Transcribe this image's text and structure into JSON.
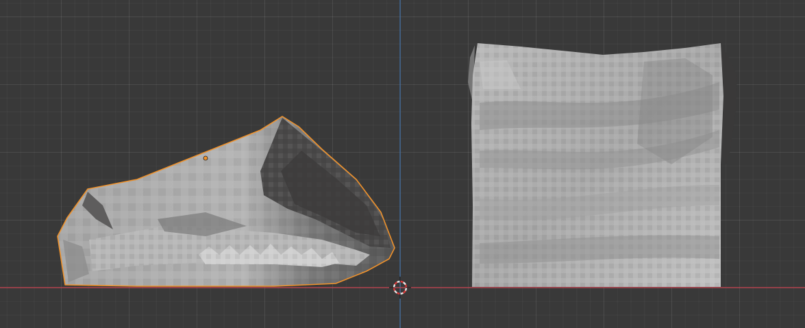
{
  "viewport": {
    "view": "front-orthographic",
    "colors": {
      "background": "#393939",
      "x_axis": "#c5404e",
      "z_axis": "#3f6fa6",
      "selection_outline": "#f0922b",
      "mesh_light": "#b8b8b8",
      "mesh_mid": "#8e8e8e",
      "mesh_dark": "#3f3e3e"
    }
  },
  "objects": [
    {
      "name": "sculpted-jaw-mesh",
      "selected": true,
      "active": true
    },
    {
      "name": "sculpted-block-mesh",
      "selected": false,
      "active": false
    }
  ],
  "cursor_3d": {
    "visible": true
  },
  "origin_point": {
    "visible": true
  }
}
